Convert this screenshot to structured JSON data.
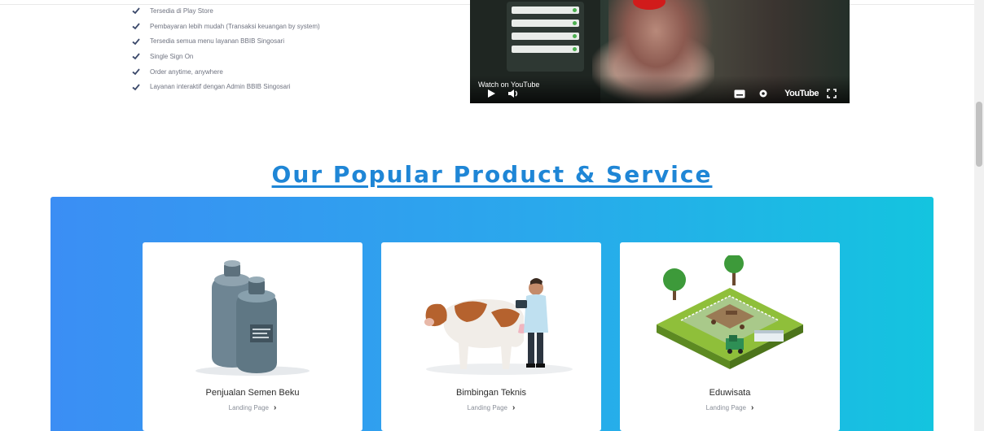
{
  "features": [
    "Tersedia di Play Store",
    "Pembayaran lebih mudah (Transaksi keuangan by system)",
    "Tersedia semua menu layanan BBIB Singosari",
    "Single Sign On",
    "Order anytime, anywhere",
    "Layanan interaktif dengan Admin BBIB Singosari"
  ],
  "video": {
    "watch_on": "Watch on YouTube",
    "brand": "YouTube"
  },
  "section_title": "Our Popular Product & Service",
  "cards": [
    {
      "title": "Penjualan Semen Beku",
      "link": "Landing Page",
      "icon": "liquid-nitrogen-container-icon"
    },
    {
      "title": "Bimbingan Teknis",
      "link": "Landing Page",
      "icon": "cow-inspection-icon"
    },
    {
      "title": "Eduwisata",
      "link": "Landing Page",
      "icon": "farm-tour-icon"
    }
  ],
  "colors": {
    "title": "#1f86d6",
    "panel_start": "#3b8ef4",
    "panel_end": "#14c4df",
    "check": "#3c4a6b"
  }
}
